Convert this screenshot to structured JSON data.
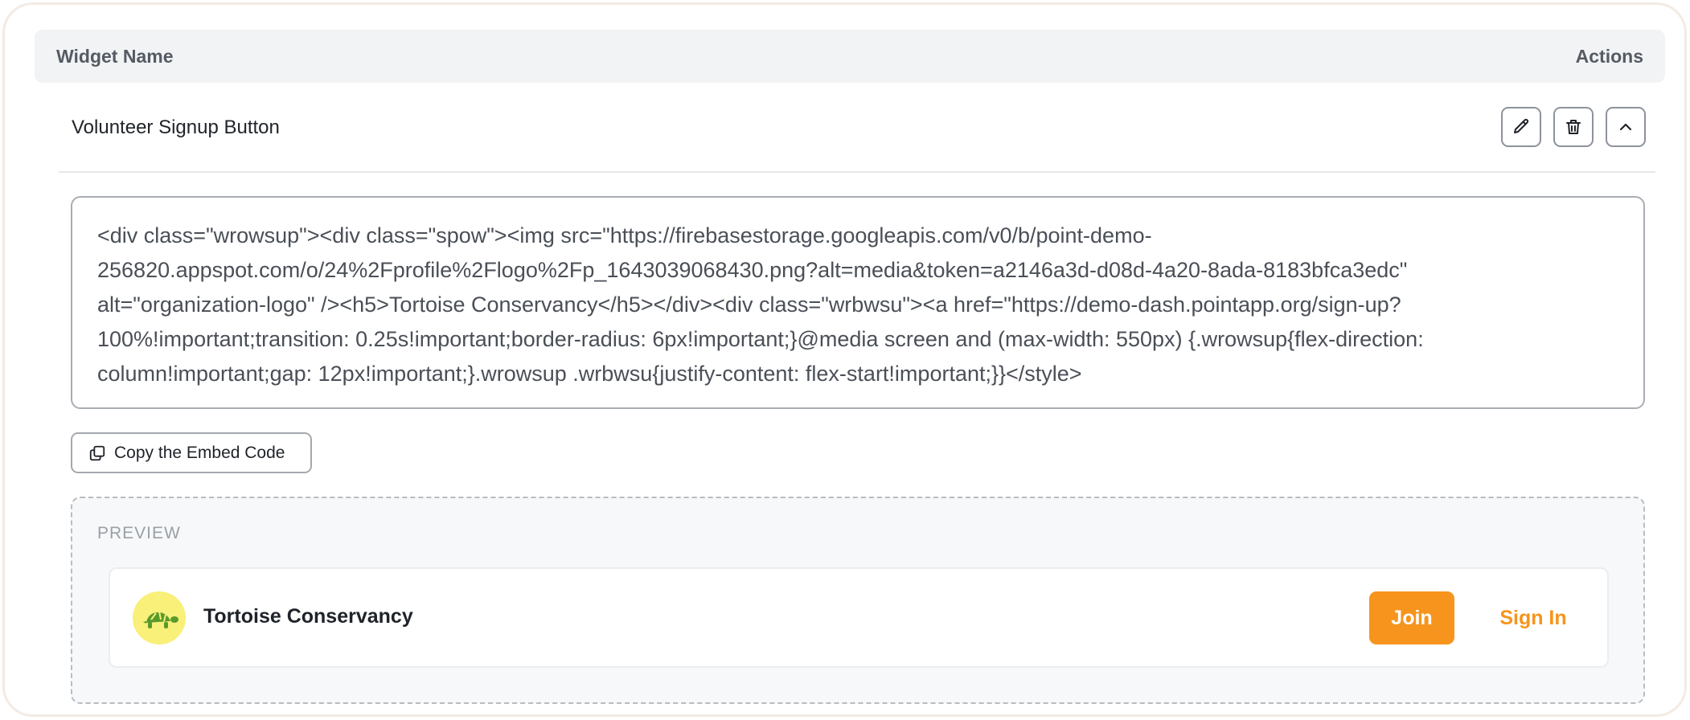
{
  "table": {
    "header_name": "Widget Name",
    "header_actions": "Actions"
  },
  "row": {
    "name": "Volunteer Signup Button",
    "actions": [
      "pencil-icon",
      "trash-icon",
      "chevron-up-icon"
    ]
  },
  "embed": {
    "lines": [
      "<div class=\"wrowsup\"><div class=\"spow\"><img src=\"https://firebasestorage.googleapis.com/v0/b/point-demo-",
      "256820.appspot.com/o/24%2Fprofile%2Flogo%2Fp_1643039068430.png?alt=media&token=a2146a3d-d08d-4a20-8ada-8183bfca3edc\"",
      "alt=\"organization-logo\" /><h5>Tortoise Conservancy</h5></div><div class=\"wrbwsu\"><a href=\"https://demo-dash.pointapp.org/sign-up?",
      "100%!important;transition: 0.25s!important;border-radius: 6px!important;}@media screen and (max-width: 550px) {.wrowsup{flex-direction:",
      "column!important;gap: 12px!important;}.wrowsup .wrbwsu{justify-content: flex-start!important;}}</style>"
    ],
    "copy_label": "Copy the Embed Code"
  },
  "preview": {
    "label": "PREVIEW",
    "org_name": "Tortoise Conservancy",
    "join_label": "Join",
    "signin_label": "Sign In",
    "accent": "#f7941d",
    "logo_bg": "#f8f079"
  }
}
